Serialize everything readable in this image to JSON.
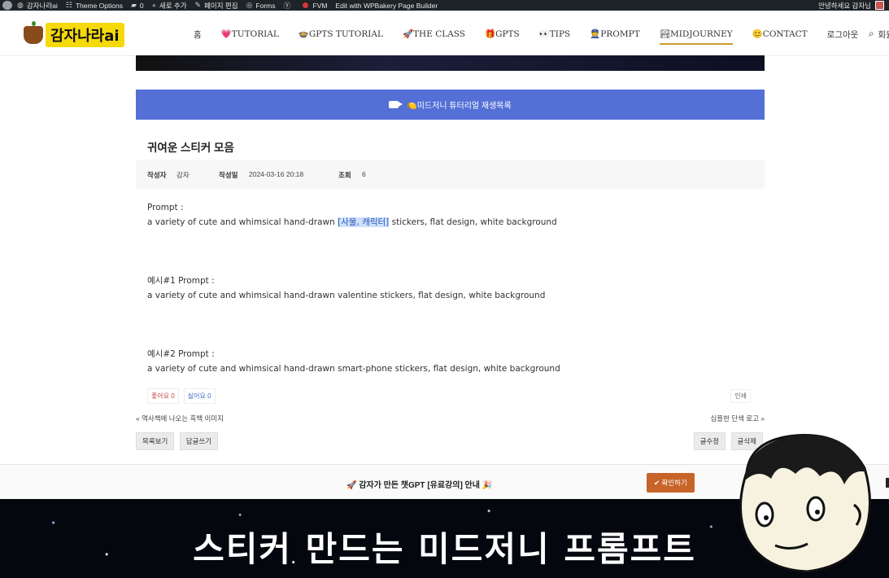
{
  "adminbar": {
    "site": "감자나라ai",
    "theme_options": "Theme Options",
    "comments": "0",
    "new": "새로 추가",
    "edit_page": "페이지 편집",
    "forms": "Forms",
    "fvm": "FVM",
    "wpbakery": "Edit with WPBakery Page Builder",
    "greeting": "안녕하세요 감자님"
  },
  "header": {
    "logo": "감자나라ai",
    "nav": [
      "홈",
      "💗TUTORIAL",
      "🍲GPTS TUTORIAL",
      "🚀THE CLASS",
      "🎁GPTS",
      "👀TIPS",
      "👮PROMPT",
      "🏞MIDJOURNEY",
      "😊CONTACT",
      "로그아웃",
      "회원정보"
    ],
    "active": "🏞MIDJOURNEY"
  },
  "playlist": {
    "label": "🍋미드저니 튜터리얼 재생목록"
  },
  "post": {
    "title": "귀여운 스티커 모음",
    "author_label": "작성자",
    "author": "감자",
    "date_label": "작성일",
    "date": "2024-03-16 20:18",
    "views_label": "조회",
    "views": "6"
  },
  "content": {
    "p1_label": "Prompt :",
    "p1_a": "a variety of cute and whimsical hand-drawn ",
    "p1_hl": "[사물, 캐릭터]",
    "p1_b": " stickers, flat design, white background",
    "p2_label": "예시#1 Prompt :",
    "p2": "a variety of cute and whimsical hand-drawn valentine stickers, flat design, white background",
    "p3_label": "예시#2 Prompt :",
    "p3": "a variety of cute and whimsical hand-drawn smart-phone stickers, flat design, white background"
  },
  "reactions": {
    "like": "좋아요 0",
    "dislike": "싫어요 0",
    "print": "인쇄"
  },
  "nav_posts": {
    "prev": "역사책에 나오는 흑백 이미지",
    "next": "심플한 단색 로고"
  },
  "buttons": {
    "list": "목록보기",
    "reply": "답글쓰기",
    "edit": "글수정",
    "delete": "글삭제"
  },
  "notice": {
    "message": "🚀 감자가 만든 챗GPT [유료강의] 안내 🎉",
    "ok": "✔ 확인하기"
  },
  "caption": "스티커 만드는 미드저니 프롬프트"
}
